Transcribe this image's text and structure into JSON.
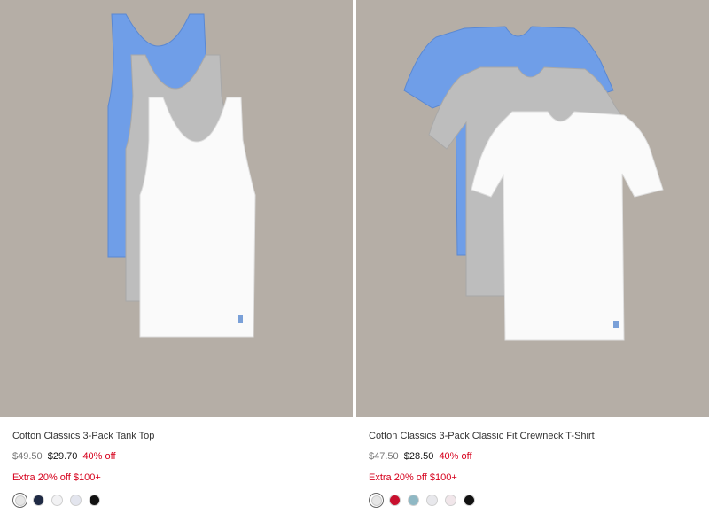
{
  "products": [
    {
      "title": "Cotton Classics 3-Pack Tank Top",
      "original_price": "$49.50",
      "sale_price": "$29.70",
      "discount": "40% off",
      "promo": "Extra 20% off $100+",
      "image_icon": "tank-top-3-pack-image",
      "swatch_colors": [
        "#e6e6e6",
        "#1f2a44",
        "#f2f2f4",
        "#e3e5ee",
        "#111111"
      ],
      "selected_swatch": 0
    },
    {
      "title": "Cotton Classics 3-Pack Classic Fit Crewneck T-Shirt",
      "original_price": "$47.50",
      "sale_price": "$28.50",
      "discount": "40% off",
      "promo": "Extra 20% off $100+",
      "image_icon": "crewneck-tshirt-3-pack-image",
      "swatch_colors": [
        "#e6e6e6",
        "#c8102e",
        "#8fb8c4",
        "#e8e8ec",
        "#f1e6ea",
        "#111111"
      ],
      "selected_swatch": 0
    }
  ],
  "colors": {
    "background": "#b5aea6",
    "sale_red": "#d6001c",
    "shirt_blue": "#6f9ee8",
    "shirt_grey": "#bdbdbd",
    "shirt_white": "#fafafa"
  }
}
